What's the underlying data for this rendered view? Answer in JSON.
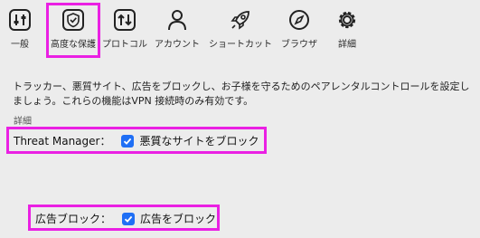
{
  "toolbar": {
    "items": [
      {
        "label": "一般",
        "icon": "sliders-icon"
      },
      {
        "label": "高度な保護",
        "icon": "shield-check-icon",
        "selected": true
      },
      {
        "label": "プロトコル",
        "icon": "arrows-swap-icon"
      },
      {
        "label": "アカウント",
        "icon": "person-icon"
      },
      {
        "label": "ショートカット",
        "icon": "rocket-icon"
      },
      {
        "label": "ブラウザ",
        "icon": "compass-icon"
      },
      {
        "label": "詳細",
        "icon": "gear-icon"
      }
    ]
  },
  "main": {
    "description": "トラッカー、悪質サイト、広告をブロックし、お子様を守るためのペアレンタルコントロールを設定しましょう。これらの機能はVPN 接続時のみ有効です。",
    "section_label": "詳細",
    "threat_manager": {
      "label": "Threat Manager：",
      "checkbox_label": "悪質なサイトをブロック",
      "checked": true
    },
    "ad_block": {
      "label": "広告ブロック：",
      "checkbox_label": "広告をブロック",
      "checked": true
    }
  },
  "colors": {
    "highlight": "#ea20e3",
    "checkbox": "#1f6ff5",
    "background": "#ececec"
  }
}
